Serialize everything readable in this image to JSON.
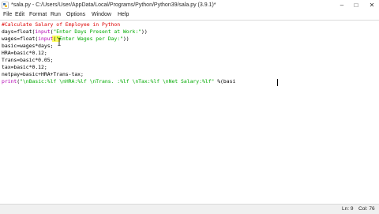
{
  "window": {
    "title": "*sala.py - C:/Users/User/AppData/Local/Programs/Python/Python39/sala.py (3.9.1)*",
    "minimize": "–",
    "maximize": "□",
    "close": "✕"
  },
  "menu": [
    "File",
    "Edit",
    "Format",
    "Run",
    "Options",
    "Window",
    "Help"
  ],
  "code": {
    "l1": "#Calculate Salary of Employee in Python",
    "l2_a": "days=float(",
    "l2_kw": "input",
    "l2_b": "(",
    "l2_str": "\"Enter Days Present at Work:\"",
    "l2_c": "))",
    "l3_a": "wages=float(",
    "l3_kw": "input",
    "l3_b": "(",
    "l3_str": "\"Enter Wages per Day:\"",
    "l3_c": "))",
    "l4": "basic=wages*days;",
    "l5": "HRA=basic*0.12;",
    "l6": "Trans=basic*0.05;",
    "l7": "tax=basic*0.12;",
    "l8": "netpay=basic+HRA+Trans-tax;",
    "l9_kw": "print",
    "l9_a": "(",
    "l9_str": "\"\\nBasic:%lf \\nHRA:%lf \\nTrans. :%lf \\nTax:%lf \\nNet Salary:%lf\"",
    "l9_b": " %(basi"
  },
  "status": {
    "ln": "Ln: 9",
    "col": "Col: 76"
  }
}
